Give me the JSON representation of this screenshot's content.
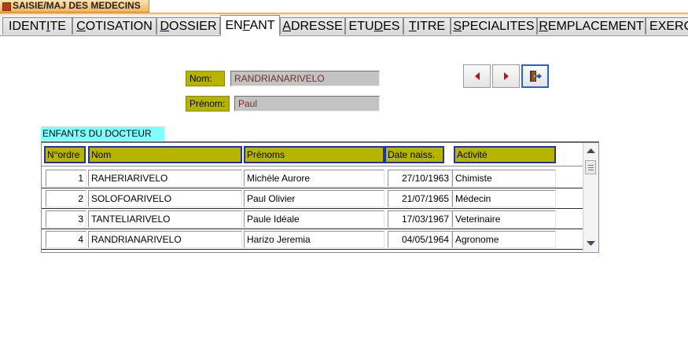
{
  "window": {
    "title": "SAISIE/MAJ DES MEDECINS"
  },
  "tabs": [
    {
      "pre": "IDENT",
      "u": "I",
      "post": "TE"
    },
    {
      "pre": "",
      "u": "C",
      "post": "OTISATION"
    },
    {
      "pre": "",
      "u": "D",
      "post": "OSSIER"
    },
    {
      "pre": "EN",
      "u": "F",
      "post": "ANT"
    },
    {
      "pre": "",
      "u": "A",
      "post": "DRESSE"
    },
    {
      "pre": "ETU",
      "u": "D",
      "post": "ES"
    },
    {
      "pre": "",
      "u": "T",
      "post": "ITRE"
    },
    {
      "pre": "",
      "u": "S",
      "post": "PECIALITES"
    },
    {
      "pre": "",
      "u": "R",
      "post": "EMPLACEMENT"
    },
    {
      "pre": "EXERC",
      "u": "",
      "post": ""
    }
  ],
  "active_tab": "ENFANT",
  "form": {
    "nom_label": "Nom:",
    "nom_value": "RANDRIANARIVELO",
    "prenom_label": "Prénom:",
    "prenom_value": "Paul"
  },
  "nav": {
    "prev_icon": "triangle-left-icon",
    "next_icon": "triangle-right-icon",
    "exit_icon": "exit-door-icon"
  },
  "subform": {
    "caption": "ENFANTS DU DOCTEUR",
    "columns": [
      "N°ordre",
      "Nom",
      "Prénoms",
      "Date naiss.",
      "Activité"
    ],
    "rows": [
      [
        "1",
        "RAHERIARIVELO",
        "Michèle Aurore",
        "27/10/1963",
        "Chimiste"
      ],
      [
        "2",
        "SOLOFOARIVELO",
        "Paul Olivier",
        "21/07/1965",
        "Médecin"
      ],
      [
        "3",
        "TANTELIARIVELO",
        "Paule Idéale",
        "17/03/1967",
        "Veterinaire"
      ],
      [
        "4",
        "RANDRIANARIVELO",
        "Harizo Jeremia",
        "04/05/1964",
        "Agronome"
      ]
    ]
  },
  "colors": {
    "label_bg": "#b7b400",
    "caption_bg": "#7fffff",
    "title_tab": "#f6b45a"
  }
}
